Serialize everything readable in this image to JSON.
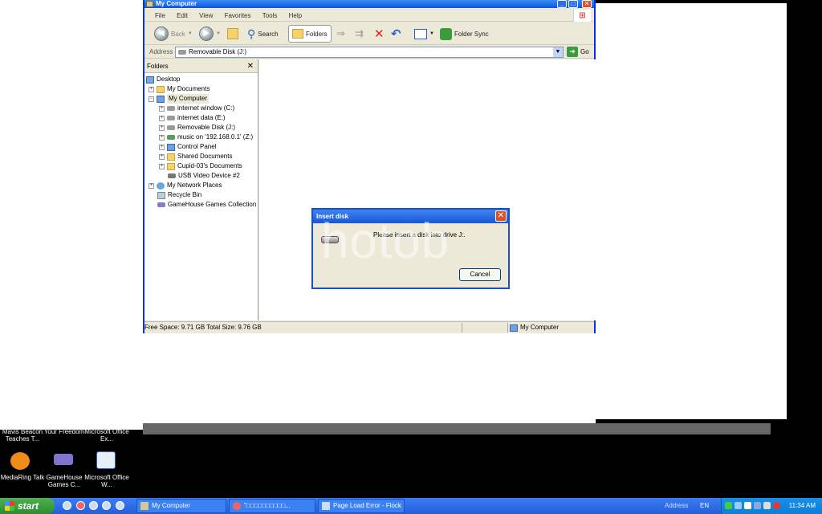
{
  "window": {
    "title": "My Computer",
    "menu": [
      "File",
      "Edit",
      "View",
      "Favorites",
      "Tools",
      "Help"
    ],
    "toolbar": {
      "back": "Back",
      "search": "Search",
      "folders": "Folders",
      "folder_sync": "Folder Sync"
    },
    "address": {
      "label": "Address",
      "value": "Removable Disk (J:)",
      "go": "Go"
    },
    "folders_panel": {
      "title": "Folders",
      "items": [
        {
          "label": "Desktop",
          "icon": "desktop-icon"
        },
        {
          "label": "My Documents",
          "icon": "folder-icon"
        },
        {
          "label": "My Computer",
          "icon": "computer-icon"
        },
        {
          "label": "internet window (C:)",
          "icon": "drive-icon"
        },
        {
          "label": "internet data (E:)",
          "icon": "drive-icon"
        },
        {
          "label": "Removable Disk (J:)",
          "icon": "removable-drive-icon"
        },
        {
          "label": "music on '192.168.0.1' (Z:)",
          "icon": "network-drive-icon"
        },
        {
          "label": "Control Panel",
          "icon": "control-panel-icon"
        },
        {
          "label": "Shared Documents",
          "icon": "folder-icon"
        },
        {
          "label": "Cupid-03's Documents",
          "icon": "folder-icon"
        },
        {
          "label": "USB Video Device #2",
          "icon": "camera-icon"
        },
        {
          "label": "My Network Places",
          "icon": "network-icon"
        },
        {
          "label": "Recycle Bin",
          "icon": "recycle-bin-icon"
        },
        {
          "label": "GameHouse Games Collection",
          "icon": "games-icon"
        }
      ]
    },
    "status": {
      "left": "Free Space: 9.71 GB Total Size: 9.76 GB",
      "right": "My Computer"
    }
  },
  "dialog": {
    "title": "Insert disk",
    "message": "Please insert a disk into drive J:.",
    "cancel": "Cancel"
  },
  "watermark": "hotob",
  "desktop_icons": [
    {
      "label": "Mavis Beacon Teaches T..."
    },
    {
      "label": "Your Freedom"
    },
    {
      "label": "Microsoft Office Ex..."
    },
    {
      "label": "MediaRing Talk"
    },
    {
      "label": "GameHouse Games C..."
    },
    {
      "label": "Microsoft Office W..."
    }
  ],
  "taskbar": {
    "start": "start",
    "tasks": [
      "My Computer",
      "\"□□□□□□□□□□...",
      "Page Load Error - Flock"
    ],
    "address_label": "Address",
    "lang": "EN",
    "clock": "11:34 AM"
  }
}
